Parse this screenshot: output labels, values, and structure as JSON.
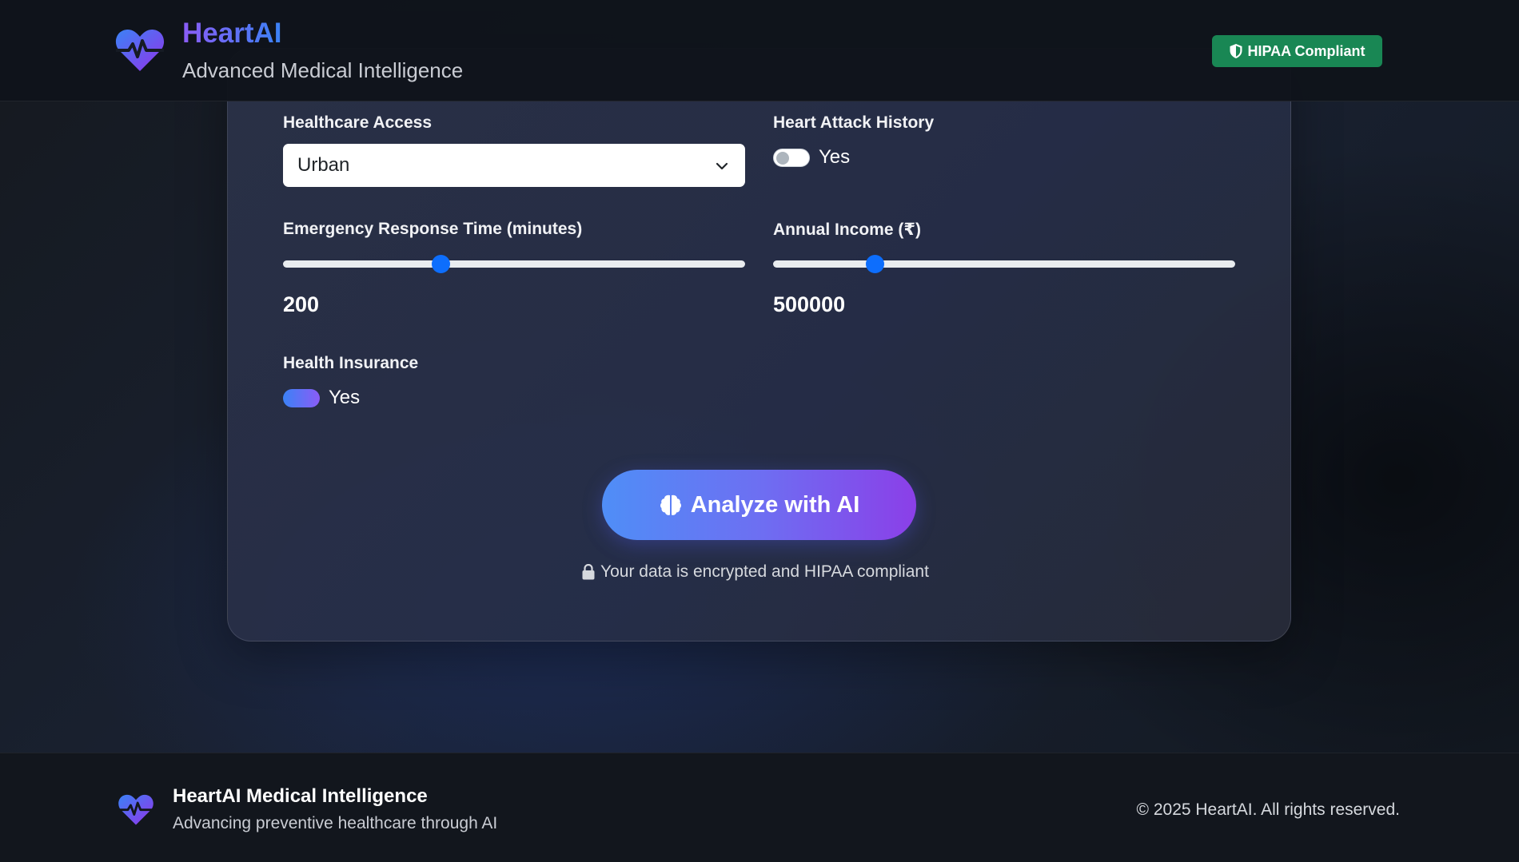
{
  "header": {
    "brand_title": "HeartAI",
    "brand_subtitle": "Advanced Medical Intelligence",
    "badge_label": "HIPAA Compliant",
    "badge_icon": "shield-icon",
    "logo_icon": "heart-pulse-icon"
  },
  "form": {
    "healthcare_access": {
      "label": "Healthcare Access",
      "selected": "Urban"
    },
    "heart_attack_history": {
      "label": "Heart Attack History",
      "toggle_label": "Yes",
      "checked": false
    },
    "emergency_response_time": {
      "label": "Emergency Response Time (minutes)",
      "value": "200",
      "fill_fraction": 0.34
    },
    "annual_income": {
      "label": "Annual Income (₹)",
      "value": "500000",
      "fill_fraction": 0.22
    },
    "health_insurance": {
      "label": "Health Insurance",
      "toggle_label": "Yes",
      "checked": true
    }
  },
  "actions": {
    "analyze_label": "Analyze with AI",
    "analyze_icon": "brain-icon",
    "secure_note": "Your data is encrypted and HIPAA compliant",
    "secure_icon": "lock-icon"
  },
  "footer": {
    "title": "HeartAI Medical Intelligence",
    "tagline": "Advancing preventive healthcare through AI",
    "copyright": "© 2025 HeartAI. All rights reserved."
  },
  "colors": {
    "brand_purple": "#8b5cf6",
    "brand_blue": "#3b82f6",
    "badge_green": "#198754",
    "slider_blue": "#0d6efd"
  }
}
